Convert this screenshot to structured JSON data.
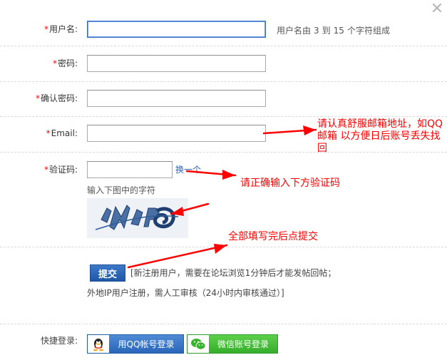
{
  "form": {
    "required_mark": "*",
    "username": {
      "label": "用户名:",
      "value": "",
      "hint_prefix": "用户名由",
      "hint_min": "3",
      "hint_mid": "到",
      "hint_max": "15",
      "hint_suffix": "个字符组成"
    },
    "password": {
      "label": "密码:",
      "value": ""
    },
    "confirm": {
      "label": "确认密码:",
      "value": ""
    },
    "email": {
      "label": "Email:",
      "value": ""
    },
    "captcha": {
      "label": "验证码:",
      "value": "",
      "switch_link": "换一个",
      "tip": "输入下图中的字符"
    },
    "submit_label": "提交",
    "notice_line1": "[新注册用户，需要在论坛浏览1分钟后才能发帖回帖；",
    "notice_line2": "外地IP用户注册，需人工审核（24小时内审核通过）]"
  },
  "quick_login": {
    "label": "快捷登录:",
    "qq_label": "用QQ帐号登录",
    "wechat_label": "微信账号登录"
  },
  "annotations": {
    "email_note": "请认真舒服邮箱地址，如QQ邮箱  以方便日后账号丢失找回",
    "captcha_note": "请正确输入下方验证码",
    "submit_note": "全部填写完后点提交"
  },
  "colors": {
    "annotation": "#ff0000",
    "required": "#ff0000",
    "link": "#3464b8",
    "qq_button": "#2a66b8",
    "wechat_button": "#35ae2b"
  },
  "icons": {
    "close": "close-icon",
    "qq": "qq-penguin-icon",
    "wechat": "wechat-icon"
  }
}
